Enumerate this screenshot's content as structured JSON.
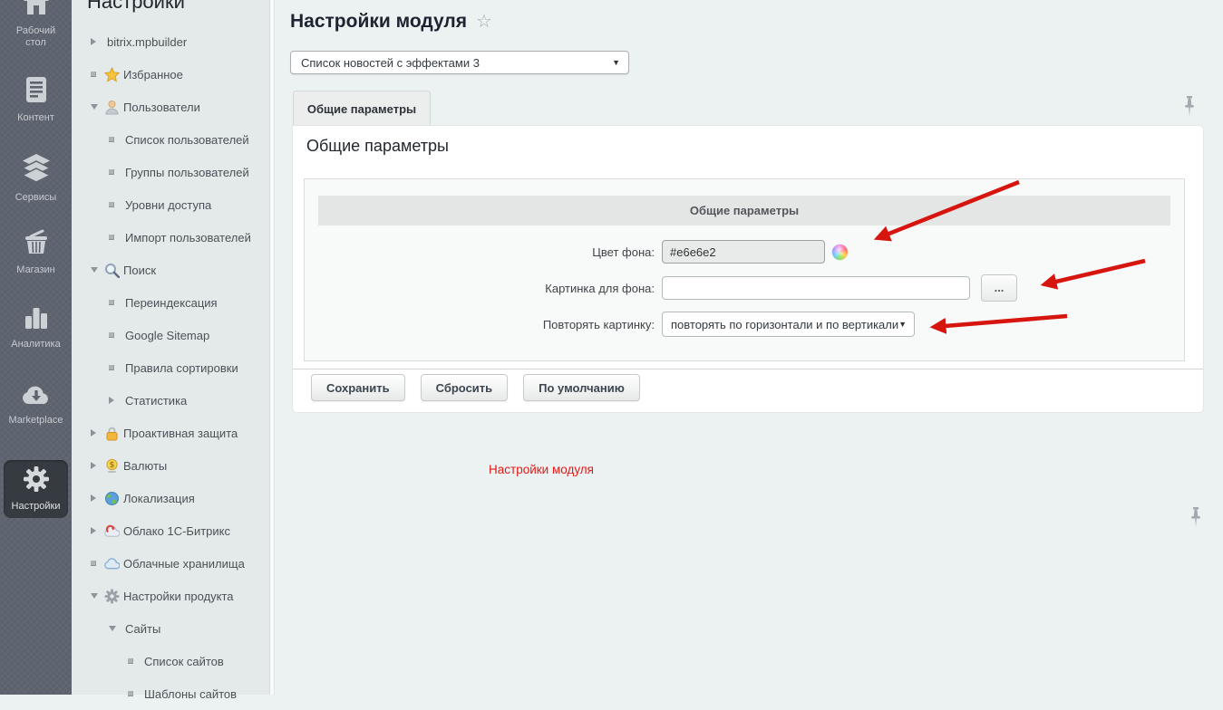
{
  "left_rail": {
    "items": [
      {
        "label": "Рабочий стол"
      },
      {
        "label": "Контент"
      },
      {
        "label": "Сервисы"
      },
      {
        "label": "Магазин"
      },
      {
        "label": "Аналитика"
      },
      {
        "label": "Marketplace"
      },
      {
        "label": "Настройки",
        "active": true
      }
    ]
  },
  "sidebar": {
    "title": "Настройки",
    "items": [
      {
        "label": "bitrix.mpbuilder"
      },
      {
        "label": "Избранное"
      },
      {
        "label": "Пользователи"
      },
      {
        "label": "Список пользователей"
      },
      {
        "label": "Группы пользователей"
      },
      {
        "label": "Уровни доступа"
      },
      {
        "label": "Импорт пользователей"
      },
      {
        "label": "Поиск"
      },
      {
        "label": "Переиндексация"
      },
      {
        "label": "Google Sitemap"
      },
      {
        "label": "Правила сортировки"
      },
      {
        "label": "Статистика"
      },
      {
        "label": "Проактивная защита"
      },
      {
        "label": "Валюты"
      },
      {
        "label": "Локализация"
      },
      {
        "label": "Облако 1С-Битрикс"
      },
      {
        "label": "Облачные хранилища"
      },
      {
        "label": "Настройки продукта"
      },
      {
        "label": "Сайты"
      },
      {
        "label": "Список сайтов"
      },
      {
        "label": "Шаблоны сайтов"
      }
    ]
  },
  "main": {
    "page_title": "Настройки модуля",
    "module_select": {
      "value": "Список новостей с эффектами 3"
    },
    "tab_label": "Общие параметры",
    "section_heading": "Общие параметры",
    "group_header": "Общие параметры",
    "fields": [
      {
        "label": "Цвет фона:",
        "value": "#e6e6e2"
      },
      {
        "label": "Картинка для фона:",
        "value": "",
        "browse_label": "..."
      },
      {
        "label": "Повторять картинку:",
        "value": "повторять по горизонтали и по вертикали"
      }
    ],
    "buttons": [
      {
        "label": "Сохранить"
      },
      {
        "label": "Сбросить"
      },
      {
        "label": "По умолчанию"
      }
    ],
    "annotation": "Настройки модуля"
  },
  "colors": {
    "accent_red": "#d6150f",
    "background_color_value": "#e6e6e2"
  }
}
